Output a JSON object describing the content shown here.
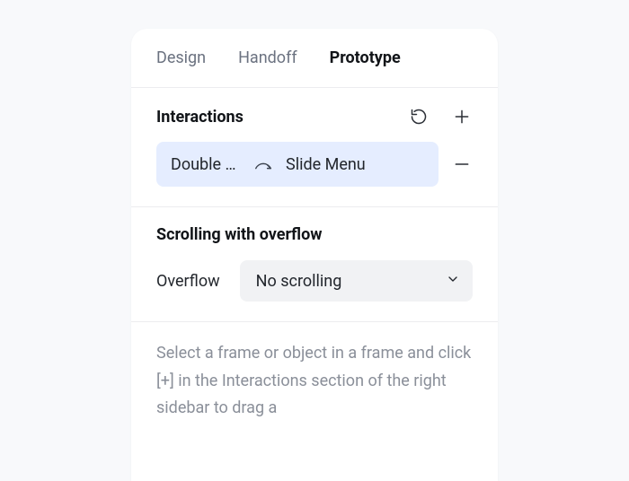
{
  "tabs": {
    "design": "Design",
    "handoff": "Handoff",
    "prototype": "Prototype",
    "active": "prototype"
  },
  "interactions": {
    "title": "Interactions",
    "items": [
      {
        "trigger": "Double click",
        "target": "Slide Menu"
      }
    ]
  },
  "scrolling": {
    "title": "Scrolling with overflow",
    "label": "Overflow",
    "value": "No scrolling"
  },
  "helper_text": "Select a frame or object in a frame and click [+] in the Interactions section of the right sidebar to drag a"
}
